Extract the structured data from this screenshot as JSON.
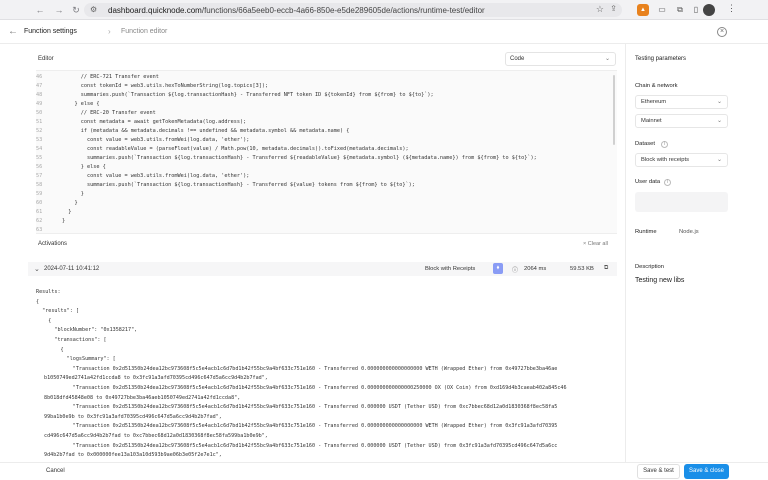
{
  "browser": {
    "url_host": "dashboard.quicknode.com",
    "url_path": "/functions/66a5eeb0-eccb-4a66-850e-e5de289605de/actions/runtime-test/editor",
    "icons": [
      "back-icon",
      "forward-icon",
      "reload-icon",
      "site-settings-icon",
      "star-icon",
      "share-icon",
      "metamask-icon",
      "wallet-icon",
      "extensions-icon",
      "sidebar-icon",
      "profile-avatar",
      "menu-icon"
    ]
  },
  "header": {
    "tab_settings": "Function settings",
    "tab_editor": "Function editor"
  },
  "editor": {
    "label": "Editor",
    "language": "Code",
    "lines": [
      {
        "n": "46",
        "code": "      // ERC-721 Transfer event"
      },
      {
        "n": "47",
        "code": "      const tokenId = web3.utils.hexToNumberString(log.topics[3]);"
      },
      {
        "n": "48",
        "code": "      summaries.push(`Transaction ${log.transactionHash} - Transferred NFT token ID ${tokenId} from ${from} to ${to}`);"
      },
      {
        "n": "49",
        "code": "    } else {"
      },
      {
        "n": "50",
        "code": "      // ERC-20 Transfer event"
      },
      {
        "n": "51",
        "code": "      const metadata = await getTokenMetadata(log.address);"
      },
      {
        "n": "52",
        "code": "      if (metadata && metadata.decimals !== undefined && metadata.symbol && metadata.name) {"
      },
      {
        "n": "53",
        "code": "        const value = web3.utils.fromWei(log.data, 'ether');"
      },
      {
        "n": "54",
        "code": "        const readableValue = (parseFloat(value) / Math.pow(10, metadata.decimals)).toFixed(metadata.decimals);"
      },
      {
        "n": "55",
        "code": "        summaries.push(`Transaction ${log.transactionHash} - Transferred ${readableValue} ${metadata.symbol} (${metadata.name}) from ${from} to ${to}`);"
      },
      {
        "n": "56",
        "code": "      } else {"
      },
      {
        "n": "57",
        "code": "        const value = web3.utils.fromWei(log.data, 'ether');"
      },
      {
        "n": "58",
        "code": "        summaries.push(`Transaction ${log.transactionHash} - Transferred ${value} tokens from ${from} to ${to}`);"
      },
      {
        "n": "59",
        "code": "      }"
      },
      {
        "n": "60",
        "code": "    }"
      },
      {
        "n": "61",
        "code": "  }"
      },
      {
        "n": "62",
        "code": "}"
      },
      {
        "n": "63",
        "code": ""
      }
    ]
  },
  "activations": {
    "label": "Activations",
    "clear_all": "Clear all",
    "row": {
      "timestamp": "2024-07-11 10:41:12",
      "dataset": "Block with Receipts",
      "duration": "2064 ms",
      "size": "59.53 KB"
    },
    "results": [
      "Results:",
      "{",
      "  \"results\": [",
      "    {",
      "      \"blockNumber\": \"0x1358217\",",
      "      \"transactions\": [",
      "        {",
      "          \"logsSummary\": [",
      "            \"Transaction 0x2d51350b24dea12bc973608f5c5e4acb1c6d7bd1b42f55bc9a4bf633c751e160 - Transferred 0.000000000000000000 WETH (Wrapped Ether) from 0x49727bbe3ba46ae",
      "b1050749ed2741a42fd1ccda8 to 0x3fc91a3afd70395cd496c647d5a6cc9d4b2b7fad\",",
      "            \"Transaction 0x2d51350b24dea12bc973608f5c5e4acb1c6d7bd1b42f55bc9a4bf633c751e160 - Transferred 0.000000000000000250000 OX (OX Coin) from 0xd169d4b3caeab402a845c46",
      "8b018dfd45848e08 to 0x49727bbe3ba46aeb1050749ed2741a42fd1ccda8\",",
      "            \"Transaction 0x2d51350b24dea12bc973608f5c5e4acb1c6d7bd1b42f55bc9a4bf633c751e160 - Transferred 0.000000 USDT (Tether USD) from 0xc7bbec68d12a0d1830368f8ec58fa5",
      "99ba1b0e9b to 0x3fc91a3afd70395cd496c647d5a6cc9d4b2b7fad\",",
      "            \"Transaction 0x2d51350b24dea12bc973608f5c5e4acb1c6d7bd1b42f55bc9a4bf633c751e160 - Transferred 0.000000000000000000 WETH (Wrapped Ether) from 0x3fc91a3afd70395",
      "cd496c647d5a6cc9d4b2b7fad to 0xc7bbec68d12a0d1830368f8ec58fa599ba1b0e9b\",",
      "            \"Transaction 0x2d51350b24dea12bc973608f5c5e4acb1c6d7bd1b42f55bc9a4bf633c751e160 - Transferred 0.000000 USDT (Tether USD) from 0x3fc91a3afd70395cd496c647d5a6cc",
      "9d4b2b7fad to 0x000000fee13a103a10d593b9ae06b3e05f2e7e1c\","
    ]
  },
  "testing": {
    "title": "Testing parameters",
    "chain_network_label": "Chain & network",
    "chain": "Ethereum",
    "network": "Mainnet",
    "dataset_label": "Dataset",
    "dataset": "Block with receipts",
    "user_data_label": "User data",
    "runtime_label": "Runtime",
    "runtime": "Node.js",
    "description_label": "Description",
    "description": "Testing new libs"
  },
  "footer": {
    "cancel": "Cancel",
    "save_test": "Save & test",
    "save_close": "Save & close"
  },
  "colors": {
    "primary_button": "#1a8fe8",
    "dataset_icon": "#8a9cf5"
  }
}
